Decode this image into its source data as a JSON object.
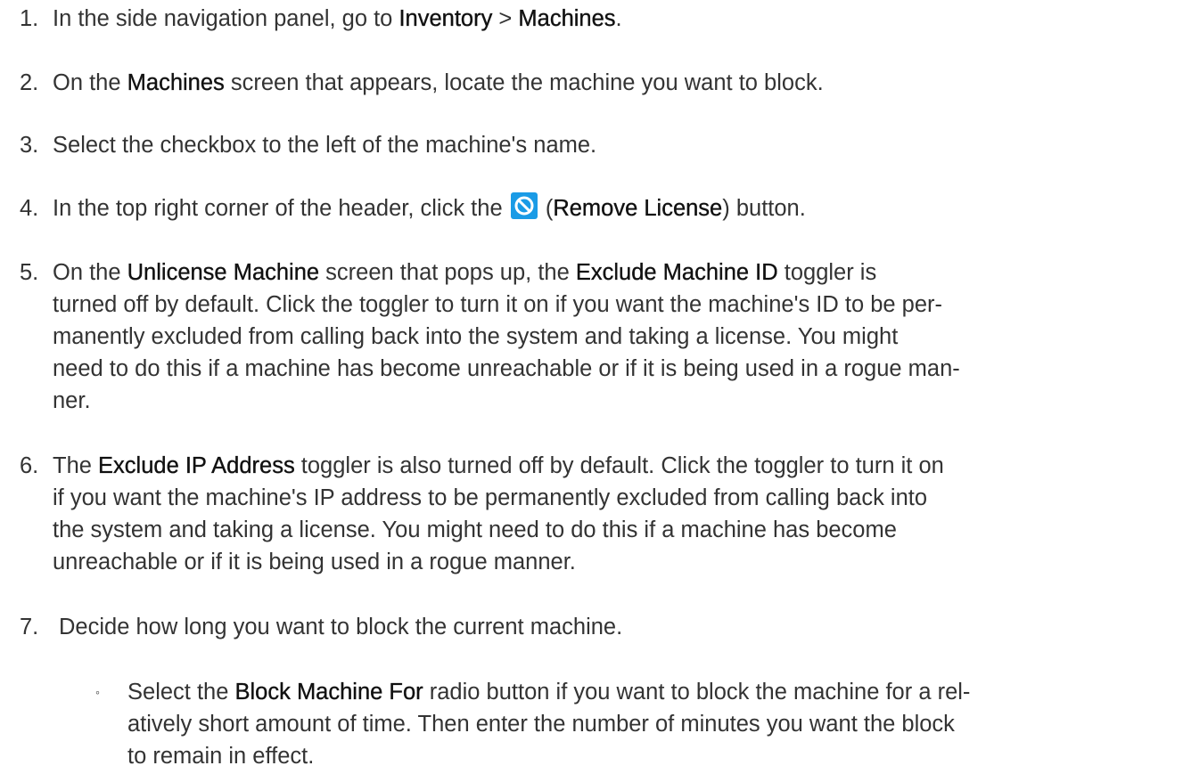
{
  "steps": [
    {
      "number": "1.",
      "parts": [
        "In the side navigation panel, go to ",
        "Inventory",
        " > ",
        "Machines",
        "."
      ]
    },
    {
      "number": "2.",
      "parts": [
        "On the ",
        "Machines",
        " screen that appears, locate the machine you want to block."
      ]
    },
    {
      "number": "3.",
      "parts": [
        "Select the checkbox to the left of the machine's name."
      ]
    },
    {
      "number": "4.",
      "parts": [
        "In the top right corner of the header, click the ",
        "(",
        "Remove License",
        ") button."
      ],
      "icon": "remove-license-icon",
      "icon_color": "#1a9be6"
    },
    {
      "number": "5.",
      "lines": [
        [
          "On the ",
          "Unlicense Machine",
          " screen that pops up, the ",
          "Exclude Machine ID",
          " toggler is"
        ],
        [
          "turned off by default. Click the toggler to turn it on if you want the machine's ID to be per-"
        ],
        [
          "manently excluded from calling back into the system and taking a license. You might"
        ],
        [
          "need to do this if a machine has become unreachable or if it is being used in a rogue man-"
        ],
        [
          "ner."
        ]
      ]
    },
    {
      "number": "6.",
      "lines": [
        [
          "The ",
          "Exclude IP Address",
          " toggler is also turned off by default. Click the toggler to turn it on"
        ],
        [
          "if you want the machine's IP address to be permanently excluded from calling back into"
        ],
        [
          "the system and taking a license. You might need to do this if a machine has become"
        ],
        [
          "unreachable or if it is being used in a rogue manner."
        ]
      ]
    },
    {
      "number": "7.",
      "parts": [
        "Decide how long you want to block the current machine."
      ]
    }
  ],
  "substeps": [
    {
      "bullet": "◦",
      "lines": [
        [
          "Select the ",
          "Block Machine For",
          " radio button if you want to block the machine for a rel-"
        ],
        [
          "atively short amount of time. Then enter the number of minutes you want the block"
        ],
        [
          "to remain in effect."
        ]
      ]
    }
  ]
}
